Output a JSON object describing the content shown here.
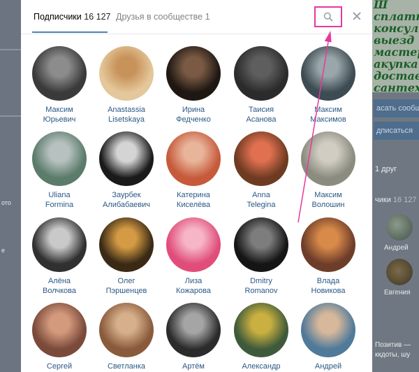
{
  "modal": {
    "tabs": [
      {
        "label": "Подписчики",
        "count": "16 127"
      },
      {
        "label": "Друзья в сообществе",
        "count": "1"
      }
    ]
  },
  "followers": [
    {
      "first": "Максим",
      "last": "Юрьевич",
      "colors": [
        "#3a3a3a",
        "#8c8c8c"
      ]
    },
    {
      "first": "Anastassia",
      "last": "Lisetskaya",
      "colors": [
        "#e4c79a",
        "#c8935a"
      ]
    },
    {
      "first": "Ирина",
      "last": "Федченко",
      "colors": [
        "#1e1712",
        "#7a5a44"
      ]
    },
    {
      "first": "Таисия",
      "last": "Асанова",
      "colors": [
        "#2b2b2b",
        "#5e5e5e"
      ]
    },
    {
      "first": "Максим",
      "last": "Максимов",
      "colors": [
        "#3d4b52",
        "#9aa6aa"
      ]
    },
    {
      "first": "Uliana",
      "last": "Formina",
      "colors": [
        "#5b7b6b",
        "#b7c2c0"
      ]
    },
    {
      "first": "Заурбек",
      "last": "Алибабаевич",
      "colors": [
        "#1a1a1a",
        "#d4d4d4"
      ]
    },
    {
      "first": "Катерина",
      "last": "Киселёва",
      "colors": [
        "#c65a3b",
        "#e8b49a"
      ]
    },
    {
      "first": "Anna",
      "last": "Telegina",
      "colors": [
        "#6e3b22",
        "#e07050"
      ]
    },
    {
      "first": "Максим",
      "last": "Волошин",
      "colors": [
        "#8b8b80",
        "#d1cdc2"
      ]
    },
    {
      "first": "Алёна",
      "last": "Волчкова",
      "colors": [
        "#303030",
        "#c9c9c9"
      ]
    },
    {
      "first": "Олег",
      "last": "Пэршенцев",
      "colors": [
        "#3a2a15",
        "#d49a44"
      ]
    },
    {
      "first": "Лиза",
      "last": "Кожарова",
      "colors": [
        "#e04d7a",
        "#f6b5c8"
      ]
    },
    {
      "first": "Dmitry",
      "last": "Romanov",
      "colors": [
        "#151515",
        "#7d7d7d"
      ]
    },
    {
      "first": "Влада",
      "last": "Новикова",
      "colors": [
        "#6e3d2a",
        "#d88a4a"
      ]
    },
    {
      "first": "Сергей",
      "last": "",
      "colors": [
        "#7a4a3a",
        "#d49a7d"
      ]
    },
    {
      "first": "Светланка",
      "last": "",
      "colors": [
        "#8a5a3d",
        "#d6b08a"
      ]
    },
    {
      "first": "Артём",
      "last": "",
      "colors": [
        "#2b2b2b",
        "#a5a5a5"
      ]
    },
    {
      "first": "Александр",
      "last": "",
      "colors": [
        "#3f5a3a",
        "#c9b040"
      ]
    },
    {
      "first": "Андрей",
      "last": "",
      "colors": [
        "#4f7a9a",
        "#d8b89a"
      ]
    }
  ],
  "background": {
    "green_lines": [
      "Ш",
      "сплатн",
      "консуль",
      "выезд",
      "мастер",
      "акупка",
      "доставк",
      "сантех"
    ],
    "right_button_1": "асать сообщ",
    "right_button_2": "дписаться",
    "friend_text": "1 друг",
    "subscribers_label": "чики",
    "subscribers_count": "16 127",
    "friend_names": [
      "Андрей",
      "Евгения"
    ],
    "bottom_text_1": "Позитив —",
    "bottom_text_2": "ккдоты, шу",
    "left_texts": [
      "ото",
      "е"
    ]
  },
  "colors": {
    "accent": "#5181b8",
    "link": "#2a5885",
    "annotation": "#e6399b"
  }
}
